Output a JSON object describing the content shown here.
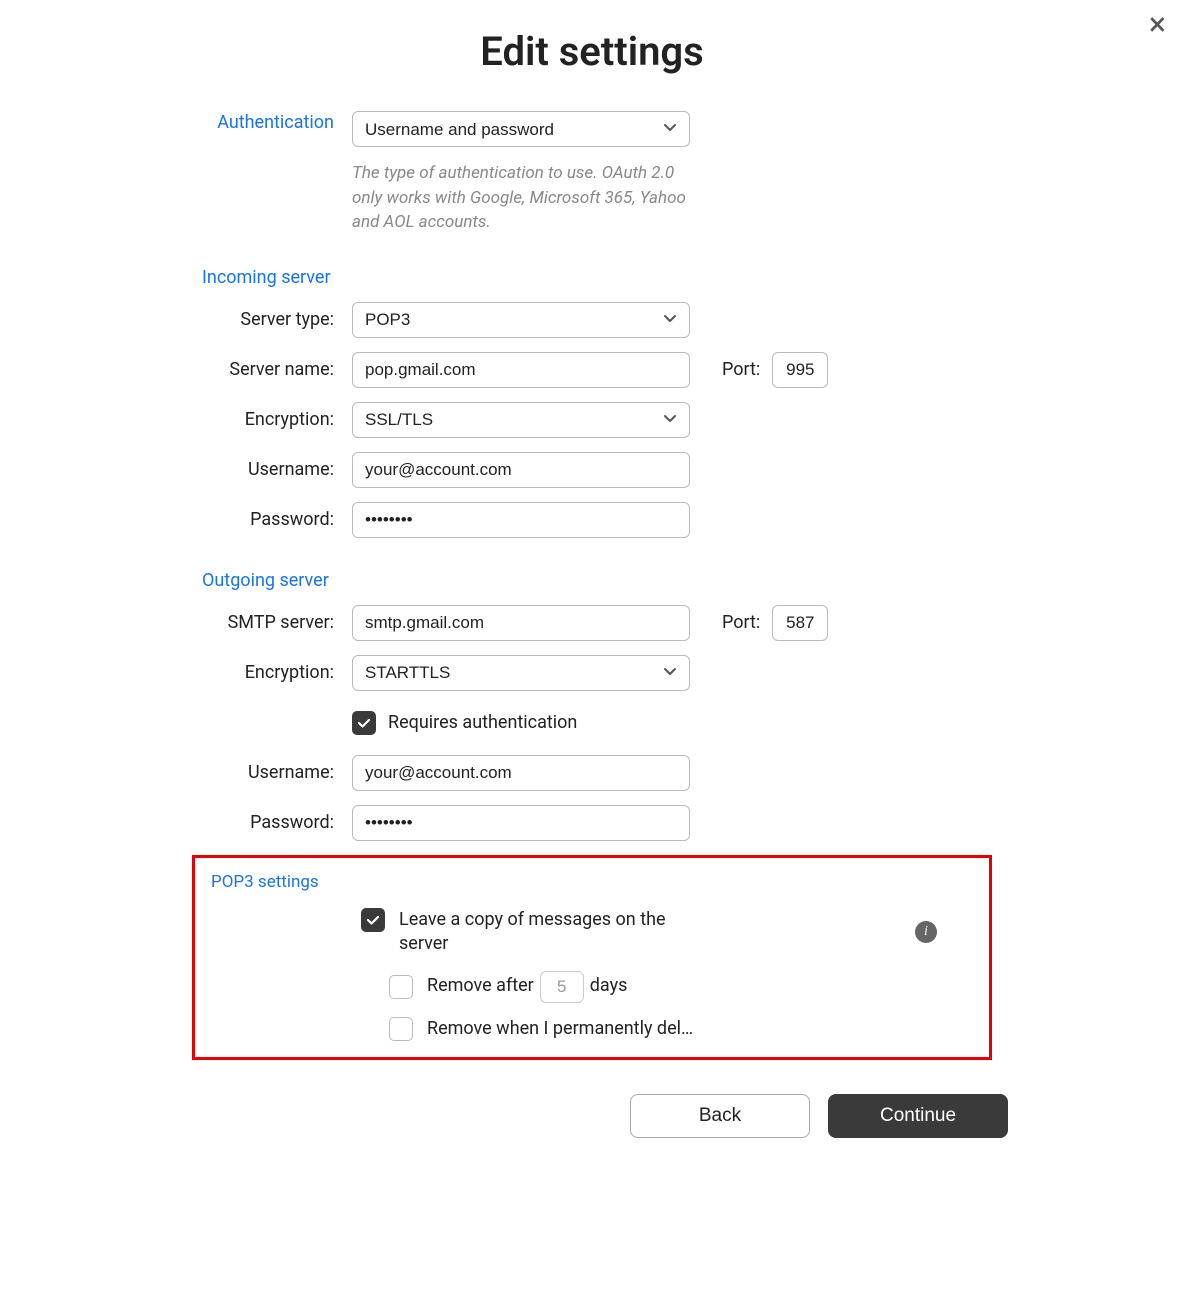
{
  "close_label": "×",
  "title": "Edit settings",
  "authentication": {
    "label": "Authentication",
    "value": "Username and password",
    "hint": "The type of authentication to use. OAuth 2.0 only works with Google, Microsoft 365, Yahoo and AOL accounts."
  },
  "incoming": {
    "section": "Incoming server",
    "server_type_label": "Server type:",
    "server_type_value": "POP3",
    "server_name_label": "Server name:",
    "server_name_value": "pop.gmail.com",
    "port_label": "Port:",
    "port_value": "995",
    "encryption_label": "Encryption:",
    "encryption_value": "SSL/TLS",
    "username_label": "Username:",
    "username_value": "your@account.com",
    "password_label": "Password:",
    "password_value": "••••••••"
  },
  "outgoing": {
    "section": "Outgoing server",
    "smtp_label": "SMTP server:",
    "smtp_value": "smtp.gmail.com",
    "port_label": "Port:",
    "port_value": "587",
    "encryption_label": "Encryption:",
    "encryption_value": "STARTTLS",
    "requires_auth_label": "Requires authentication",
    "username_label": "Username:",
    "username_value": "your@account.com",
    "password_label": "Password:",
    "password_value": "••••••••"
  },
  "pop3": {
    "section": "POP3 settings",
    "leave_copy_label": "Leave a copy of messages on the server",
    "remove_after_pre": "Remove after",
    "remove_after_days": "5",
    "remove_after_post": "days",
    "remove_permanent_label": "Remove when I permanently del…"
  },
  "footer": {
    "back": "Back",
    "continue": "Continue"
  }
}
